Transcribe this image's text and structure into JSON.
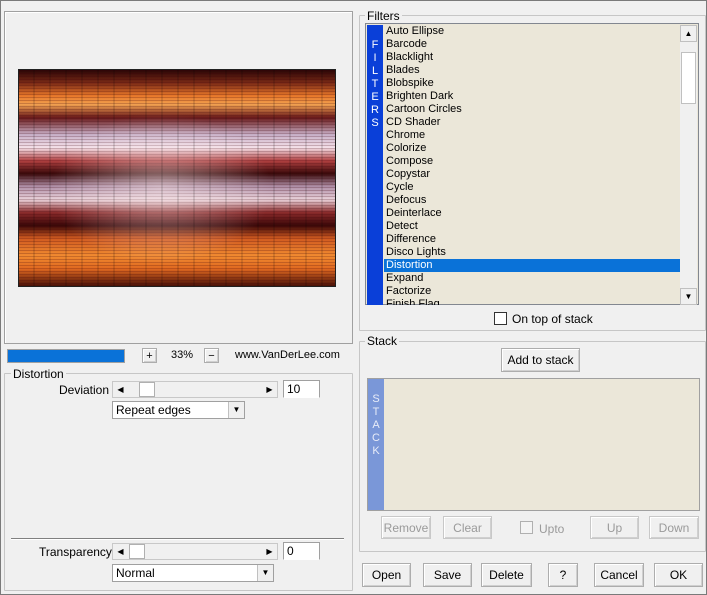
{
  "preview": {
    "zoom_in_label": "+",
    "zoom_out_label": "−",
    "zoom_value": "33%",
    "progress": 1.0,
    "website": "www.VanDerLee.com"
  },
  "distortion": {
    "group_title": "Distortion",
    "deviation_label": "Deviation",
    "deviation_value": "10",
    "edge_mode": "Repeat edges",
    "transparency_label": "Transparency",
    "transparency_value": "0",
    "blend_mode": "Normal"
  },
  "filters": {
    "group_title": "Filters",
    "tab_letters": [
      "F",
      "I",
      "L",
      "T",
      "E",
      "R",
      "S"
    ],
    "items": [
      "Auto Ellipse",
      "Barcode",
      "Blacklight",
      "Blades",
      "Blobspike",
      "Brighten Dark",
      "Cartoon Circles",
      "CD Shader",
      "Chrome",
      "Colorize",
      "Compose",
      "Copystar",
      "Cycle",
      "Defocus",
      "Deinterlace",
      "Detect",
      "Difference",
      "Disco Lights",
      "Distortion",
      "Expand",
      "Factorize",
      "Finish Flag"
    ],
    "selected": "Distortion",
    "on_top_label": "On top of stack"
  },
  "stack": {
    "group_title": "Stack",
    "add_label": "Add to stack",
    "tab_letters": [
      "S",
      "T",
      "A",
      "C",
      "K"
    ],
    "remove_label": "Remove",
    "clear_label": "Clear",
    "upto_label": "Upto",
    "up_label": "Up",
    "down_label": "Down"
  },
  "footer": {
    "open_label": "Open",
    "save_label": "Save",
    "delete_label": "Delete",
    "help_label": "?",
    "cancel_label": "Cancel",
    "ok_label": "OK"
  },
  "colors": {
    "selection": "#0a72d8",
    "filters_tab": "#0a3fd8",
    "stack_tab": "#7a97d8",
    "list_bg": "#ebe7d9"
  }
}
